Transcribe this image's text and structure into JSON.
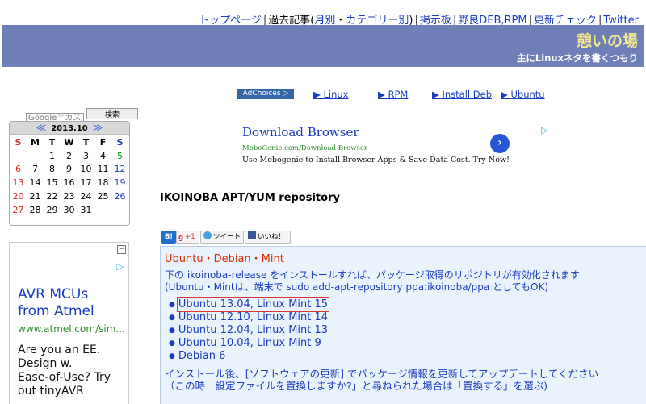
{
  "topnav": {
    "links": [
      "トップページ",
      "過去記事(",
      "月別",
      "・",
      "カテゴリー別",
      ")",
      "掲示板",
      "野良DEB,RPM",
      "更新チェック",
      "Twitter"
    ]
  },
  "site": {
    "title": "憩いの場",
    "subtitle": "主にLinuxネタを書くつもり"
  },
  "adbar": {
    "adchoices": "AdChoices ▷",
    "links": [
      "▶ Linux",
      "▶ RPM",
      "▶ Install Deb",
      "▶ Ubuntu"
    ]
  },
  "search": {
    "placeholder": "Google™カスタ",
    "button": "検索"
  },
  "calendar": {
    "month": "2013.10",
    "prev": "≪",
    "next": "≫",
    "weekdays": [
      "S",
      "M",
      "T",
      "W",
      "T",
      "F",
      "S"
    ],
    "weeks": [
      [
        "",
        "",
        "1",
        "2",
        "3",
        "4",
        "5"
      ],
      [
        "6",
        "7",
        "8",
        "9",
        "10",
        "11",
        "12"
      ],
      [
        "13",
        "14",
        "15",
        "16",
        "17",
        "18",
        "19"
      ],
      [
        "20",
        "21",
        "22",
        "23",
        "24",
        "25",
        "26"
      ],
      [
        "27",
        "28",
        "29",
        "30",
        "31",
        "",
        ""
      ]
    ]
  },
  "left_ad": {
    "close": "−",
    "headline": "AVR MCUs\nfrom Atmel",
    "url": "www.atmel.com/sim...",
    "body": "Are you an EE.\nDesign w.\nEase-of-Use? Try\nout tinyAVR"
  },
  "main_ad": {
    "title": "Download Browser",
    "url": "MoboGenie.com/Download-Browser",
    "desc": "Use Mobogenie to Install Browser Apps & Save Data Cost. Try Now!",
    "go": "›"
  },
  "page": {
    "title": "IKOINOBA APT/YUM repository"
  },
  "social": {
    "hatena": "B!",
    "gplus": "+1",
    "tweet": "ツイート",
    "like": "いいね！"
  },
  "content": {
    "heading": "Ubuntu・Debian・Mint",
    "line1": "下の ikoinoba-release をインストールすれば、パッケージ取得のリポジトリが有効化されます",
    "line2": "(Ubuntu・Mintは、端末で sudo add-apt-repository ppa:ikoinoba/ppa としてもOK)",
    "items": [
      "Ubuntu 13.04, Linux Mint 15",
      "Ubuntu 12.10, Linux Mint 14",
      "Ubuntu 12.04, Linux Mint 13",
      "Ubuntu 10.04, Linux Mint 9",
      "Debian 6"
    ],
    "after1": "インストール後、[ソフトウェアの更新] でパッケージ情報を更新してアップデートしてください",
    "after2": "（この時「設定ファイルを置換しますか?」と尋ねられた場合は「置換する」を選ぶ)"
  }
}
